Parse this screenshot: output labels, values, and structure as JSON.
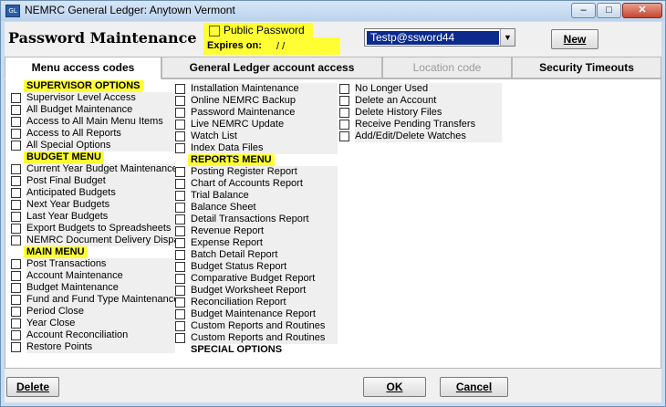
{
  "window": {
    "title": "NEMRC General Ledger: Anytown Vermont",
    "icon": "GL",
    "min": "–",
    "max": "□",
    "close": "✕"
  },
  "header": {
    "title": "Password Maintenance",
    "public_password_label": "Public Password",
    "expires_label": "Expires on:",
    "expires_value": "/ /",
    "user_value": "Testp@ssword44",
    "new_label": "New"
  },
  "tabs": [
    {
      "label": "Menu access codes"
    },
    {
      "label": "General Ledger account access"
    },
    {
      "label": "Location code"
    },
    {
      "label": "Security Timeouts"
    }
  ],
  "columns": {
    "col1": [
      {
        "label": "SUPERVISOR OPTIONS",
        "head": true
      },
      {
        "label": "Supervisor Level Access"
      },
      {
        "label": "All Budget Maintenance"
      },
      {
        "label": "Access to All Main Menu Items"
      },
      {
        "label": "Access to All Reports"
      },
      {
        "label": "All Special Options"
      },
      {
        "label": "BUDGET MENU",
        "head": true
      },
      {
        "label": "Current Year Budget Maintenance"
      },
      {
        "label": "Post Final Budget"
      },
      {
        "label": "Anticipated Budgets"
      },
      {
        "label": "Next Year Budgets"
      },
      {
        "label": "Last Year Budgets"
      },
      {
        "label": "Export Budgets to Spreadsheets"
      },
      {
        "label": "NEMRC Document Delivery Dispat"
      },
      {
        "label": "MAIN MENU",
        "head": true
      },
      {
        "label": "Post Transactions"
      },
      {
        "label": "Account Maintenance"
      },
      {
        "label": "Budget Maintenance"
      },
      {
        "label": "Fund and Fund Type Maintenance"
      },
      {
        "label": "Period Close"
      },
      {
        "label": "Year Close"
      },
      {
        "label": "Account Reconciliation"
      },
      {
        "label": "Restore Points"
      }
    ],
    "col2": [
      {
        "label": "Installation Maintenance"
      },
      {
        "label": "Online NEMRC Backup"
      },
      {
        "label": "Password Maintenance"
      },
      {
        "label": "Live NEMRC Update"
      },
      {
        "label": "Watch List"
      },
      {
        "label": "Index Data Files"
      },
      {
        "label": "REPORTS MENU",
        "head": true
      },
      {
        "label": "Posting Register Report"
      },
      {
        "label": "Chart of Accounts Report"
      },
      {
        "label": "Trial Balance"
      },
      {
        "label": "Balance Sheet"
      },
      {
        "label": "Detail Transactions Report"
      },
      {
        "label": "Revenue Report"
      },
      {
        "label": "Expense Report"
      },
      {
        "label": "Batch Detail Report"
      },
      {
        "label": "Budget Status Report"
      },
      {
        "label": "Comparative Budget Report"
      },
      {
        "label": "Budget Worksheet Report"
      },
      {
        "label": "Reconciliation Report"
      },
      {
        "label": "Budget Maintenance Report"
      },
      {
        "label": "Custom Reports and Routines"
      },
      {
        "label": "Custom Reports and Routines"
      },
      {
        "label": "SPECIAL OPTIONS",
        "head": true,
        "plain": true
      }
    ],
    "col3": [
      {
        "label": "No Longer Used"
      },
      {
        "label": "Delete an Account"
      },
      {
        "label": "Delete History Files"
      },
      {
        "label": "Receive Pending Transfers"
      },
      {
        "label": "Add/Edit/Delete Watches"
      }
    ]
  },
  "footer": {
    "delete_label": "Delete",
    "ok_label": "OK",
    "cancel_label": "Cancel"
  }
}
